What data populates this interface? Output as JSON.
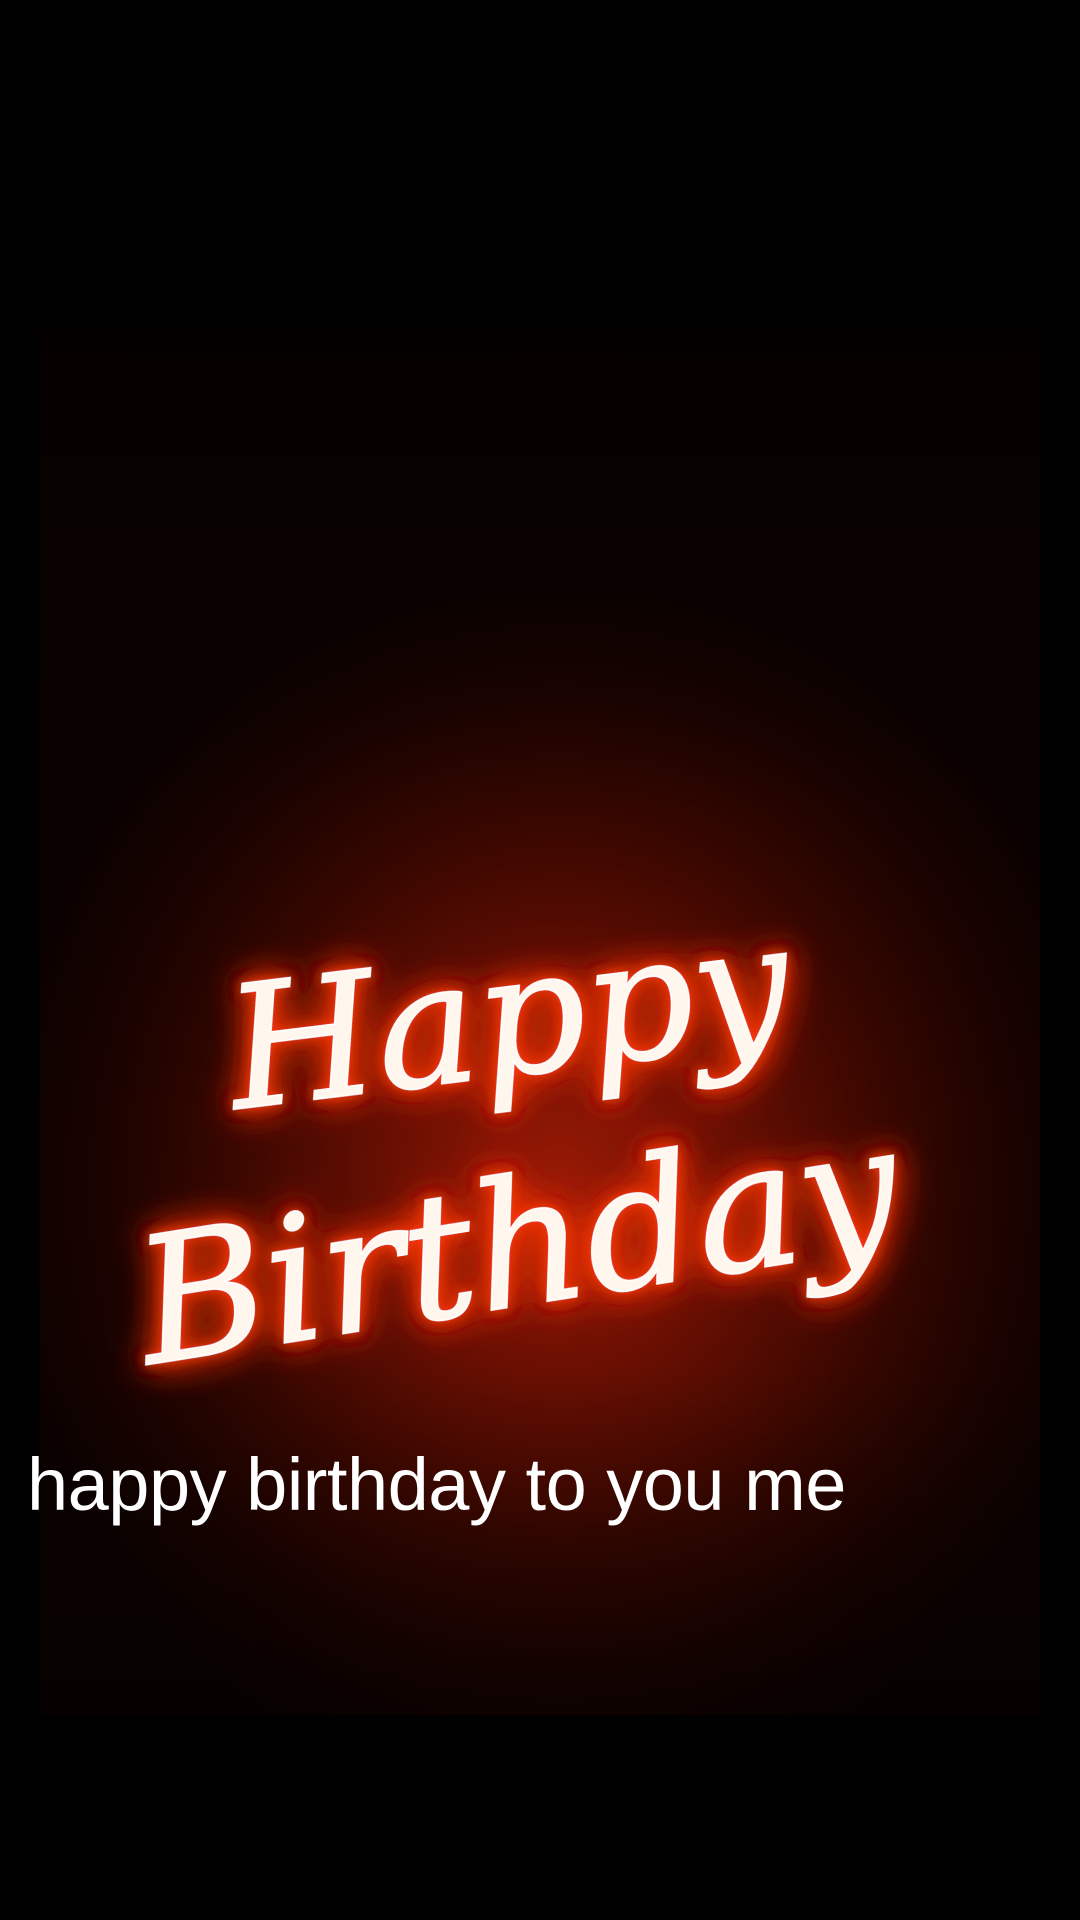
{
  "video": {
    "headline_line1": "Happy",
    "headline_line2": "Birthday",
    "glow_color": "#ff3a10",
    "background_color": "#6a0f02"
  },
  "caption": {
    "text": "happy birthday to you me"
  }
}
